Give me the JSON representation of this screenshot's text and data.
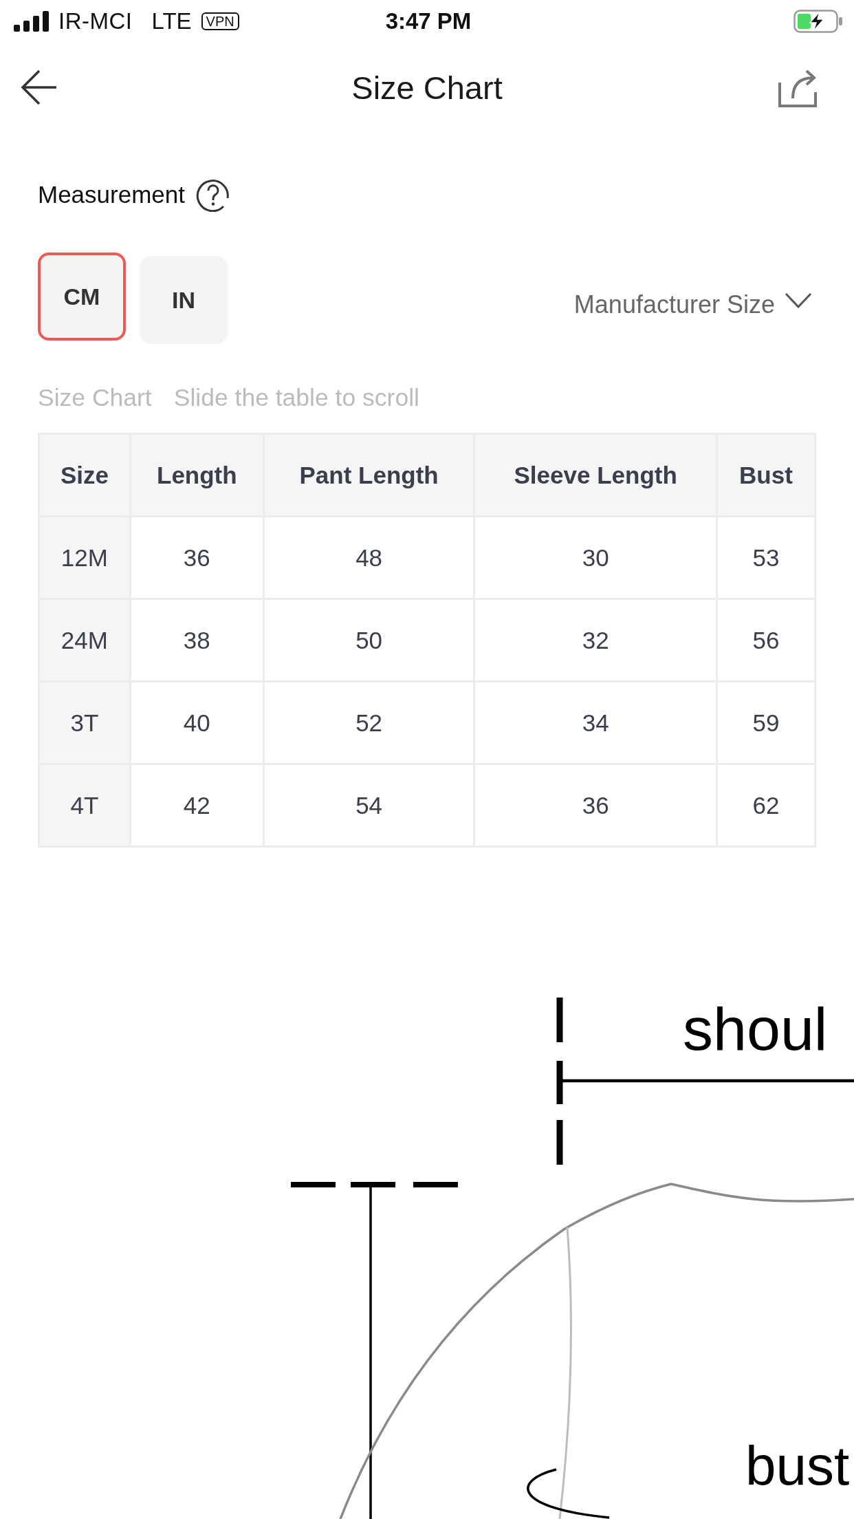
{
  "status_bar": {
    "carrier": "IR-MCI",
    "network": "LTE",
    "vpn": "VPN",
    "time": "3:47 PM",
    "charging": true
  },
  "header": {
    "title": "Size Chart"
  },
  "measurement": {
    "label": "Measurement"
  },
  "units": [
    {
      "label": "CM",
      "selected": true
    },
    {
      "label": "IN",
      "selected": false
    }
  ],
  "size_type": {
    "label": "Manufacturer Size"
  },
  "table_caption": {
    "title": "Size Chart",
    "hint": "Slide the table to scroll"
  },
  "table": {
    "columns": [
      "Size",
      "Length",
      "Pant Length",
      "Sleeve Length",
      "Bust"
    ],
    "rows": [
      [
        "12M",
        "36",
        "48",
        "30",
        "53"
      ],
      [
        "24M",
        "38",
        "50",
        "32",
        "56"
      ],
      [
        "3T",
        "40",
        "52",
        "34",
        "59"
      ],
      [
        "4T",
        "42",
        "54",
        "36",
        "62"
      ]
    ]
  },
  "diagram": {
    "shoulder_label": "shoul",
    "bust_label": "bust"
  }
}
